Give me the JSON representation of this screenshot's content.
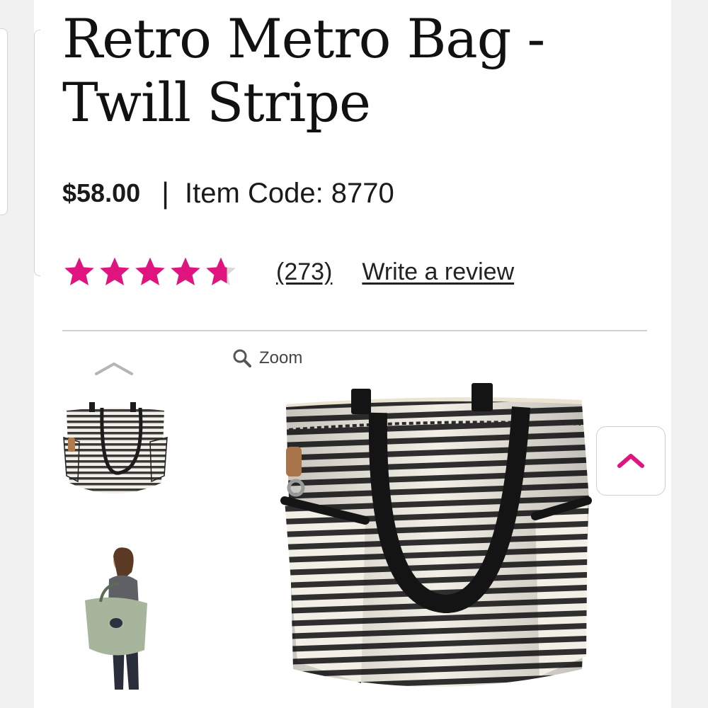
{
  "product": {
    "title": "Retro Metro Bag - Twill Stripe",
    "price": "$58.00",
    "separator": "|",
    "item_code_label": "Item Code: 8770"
  },
  "rating": {
    "stars": 4.7,
    "max_stars": 5,
    "review_count": "(273)",
    "write_review_label": "Write a review"
  },
  "gallery": {
    "zoom_label": "Zoom",
    "thumbnails": [
      "striped-tote-thumbnail",
      "model-carrying-bag-thumbnail"
    ]
  },
  "colors": {
    "accent": "#e0147f",
    "text": "#1a1a1a",
    "divider": "#cfcfcf",
    "stripe_dark": "#2b2b2b",
    "stripe_light": "#f2efe6"
  },
  "icons": {
    "thumb_prev": "chevron-up-icon",
    "zoom": "magnifier-icon",
    "back_to_top": "chevron-up-icon"
  }
}
